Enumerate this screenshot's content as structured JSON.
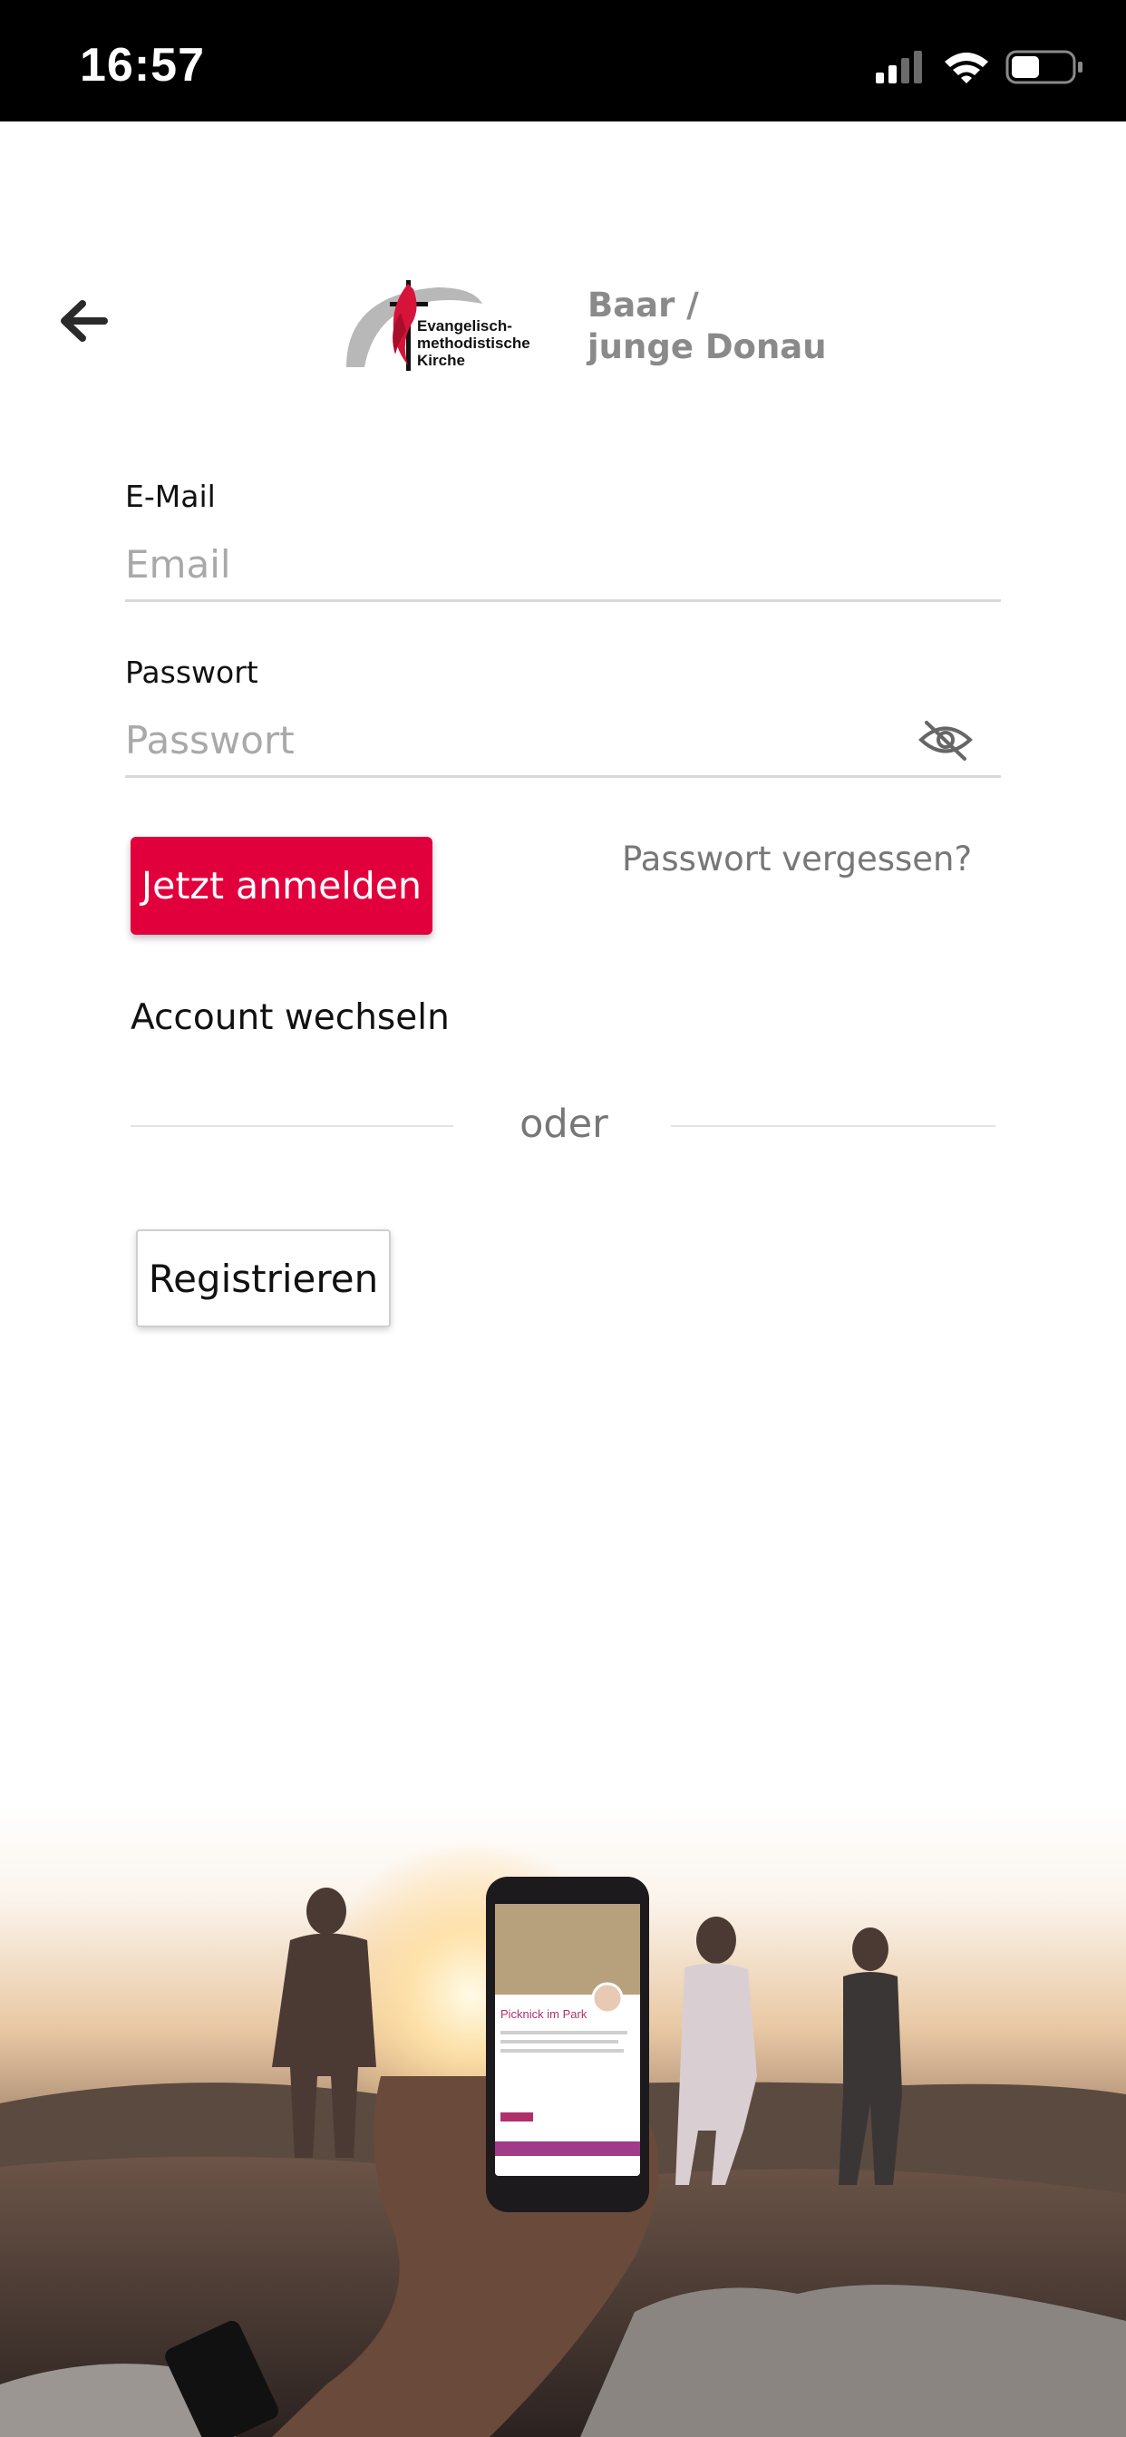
{
  "status_bar": {
    "time": "16:57"
  },
  "header": {
    "back_icon": "arrow-left-icon",
    "logo_text": [
      "Evangelisch-",
      "methodistische",
      "Kirche"
    ],
    "church_name_line1": "Baar /",
    "church_name_line2": "junge Donau"
  },
  "form": {
    "email_label": "E-Mail",
    "email_placeholder": "Email",
    "email_value": "",
    "password_label": "Passwort",
    "password_placeholder": "Passwort",
    "password_value": "",
    "password_toggle_icon": "eye-slash-icon",
    "login_button": "Jetzt anmelden",
    "forgot_password": "Passwort vergessen?",
    "switch_account": "Account wechseln",
    "divider_text": "oder",
    "register_button": "Registrieren"
  },
  "hero": {
    "phone_card_title": "Picknick im Park"
  },
  "colors": {
    "primary": "#e2003c",
    "text": "#111111",
    "muted": "#777777",
    "placeholder": "#a9a9a9",
    "church_name": "#8a8a8a"
  }
}
